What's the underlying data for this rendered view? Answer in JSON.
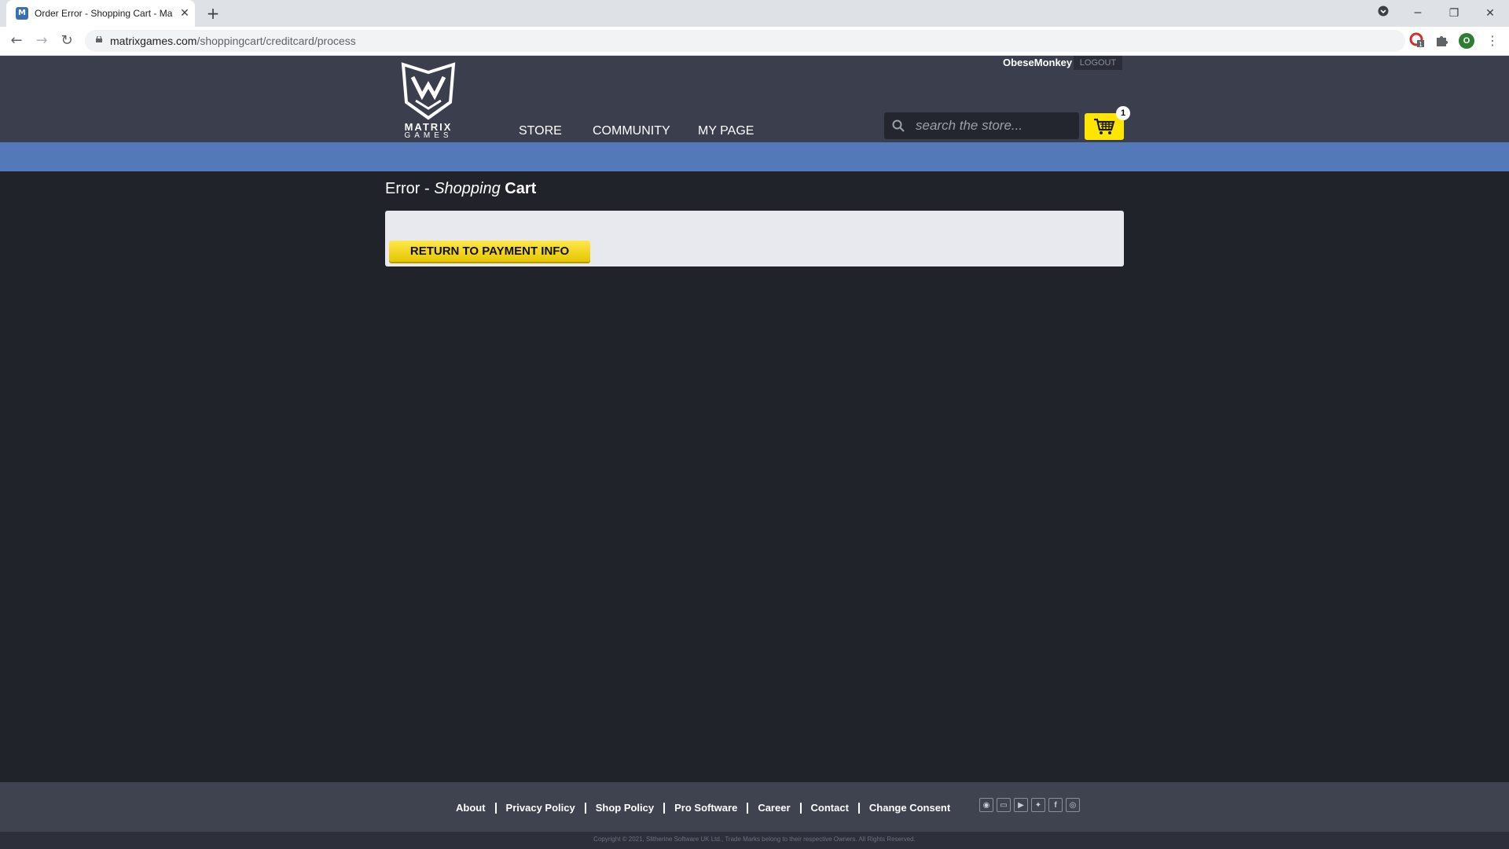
{
  "browser": {
    "tab_title": "Order Error - Shopping Cart - Ma",
    "favicon_letter": "M",
    "url_host": "matrixgames.com",
    "url_path": "/shoppingcart/creditcard/process",
    "profile_initial": "O"
  },
  "header": {
    "logo_line1": "MATRIX",
    "logo_line2": "GAMES",
    "nav": [
      "STORE",
      "COMMUNITY",
      "MY PAGE"
    ],
    "username": "ObeseMonkey",
    "logout_label": "LOGOUT",
    "search_placeholder": "search the store...",
    "cart_count": "1"
  },
  "main": {
    "title_part1": "Error - ",
    "title_part2": "Shopping",
    "title_part3": " Cart",
    "return_button": "RETURN TO PAYMENT INFO"
  },
  "footer": {
    "links": [
      "About",
      "Privacy Policy",
      "Shop Policy",
      "Pro Software",
      "Career",
      "Contact",
      "Change Consent"
    ],
    "social": [
      "discord-icon",
      "twitch-icon",
      "youtube-icon",
      "twitter-icon",
      "facebook-icon",
      "instagram-icon"
    ],
    "copyright": "Copyright © 2021, Slitherine Software UK Ltd., Trade Marks belong to their respective Owners. All Rights Reserved."
  },
  "colors": {
    "header_bg": "#3a3e4d",
    "blue_band": "#5379b8",
    "page_bg": "#202329",
    "accent_yellow": "#ffe600"
  }
}
